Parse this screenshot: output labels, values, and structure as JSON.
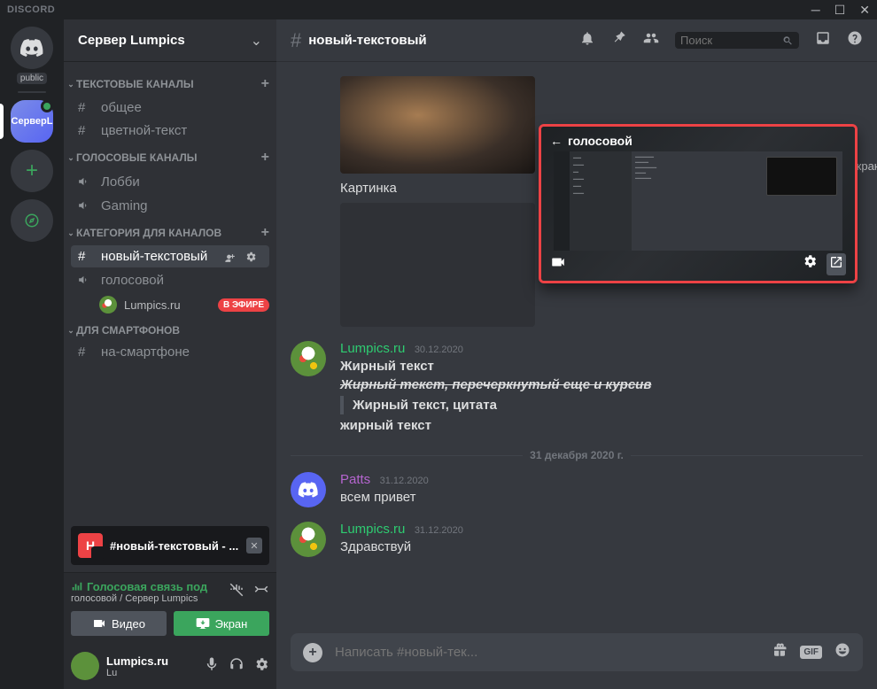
{
  "app": {
    "brand": "DISCORD"
  },
  "servers": {
    "public_label": "public",
    "active_server_short": "СерверL"
  },
  "sidebar": {
    "server_name": "Сервер Lumpics",
    "categories": {
      "text": {
        "label": "ТЕКСТОВЫЕ КАНАЛЫ"
      },
      "voice": {
        "label": "ГОЛОСОВЫЕ КАНАЛЫ"
      },
      "cat_channels": {
        "label": "КАТЕГОРИЯ ДЛЯ КАНАЛОВ"
      },
      "smartphones": {
        "label": "ДЛЯ СМАРТФОНОВ"
      }
    },
    "channels": {
      "general": "общее",
      "colored": "цветной-текст",
      "lobby": "Лобби",
      "gaming": "Gaming",
      "new_text": "новый-текстовый",
      "voice": "голосовой",
      "smartphone": "на-смартфоне"
    },
    "voice_user": "Lumpics.ru",
    "live_badge": "В ЭФИРЕ",
    "stream_card": {
      "initial": "Н",
      "label": "#новый-текстовый - ..."
    }
  },
  "voice_panel": {
    "status": "Голосовая связь под",
    "sub": "голосовой / Сервер Lumpics",
    "video_btn": "Видео",
    "screen_btn": "Экран"
  },
  "user_panel": {
    "name": "Lumpics.ru",
    "tag": "Lu"
  },
  "header": {
    "channel": "новый-текстовый",
    "search_placeholder": "Поиск"
  },
  "messages": {
    "caption": "Картинка",
    "msg1": {
      "author": "Lumpics.ru",
      "ts": "30.12.2020",
      "line1": "Жирный текст",
      "line2": "Жирный текст, перечеркнутый еще и курсив",
      "line3": "Жирный текст, цитата",
      "line4": "жирный текст"
    },
    "divider": "31 декабря 2020 г.",
    "msg2": {
      "author": "Patts",
      "ts": "31.12.2020",
      "text": "всем привет"
    },
    "msg3": {
      "author": "Lumpics.ru",
      "ts": "31.12.2020",
      "text": "Здравствуй"
    }
  },
  "input": {
    "placeholder": "Написать #новый-тек...",
    "gif": "GIF"
  },
  "pip": {
    "title": "голосовой",
    "side_text": "й экран"
  }
}
